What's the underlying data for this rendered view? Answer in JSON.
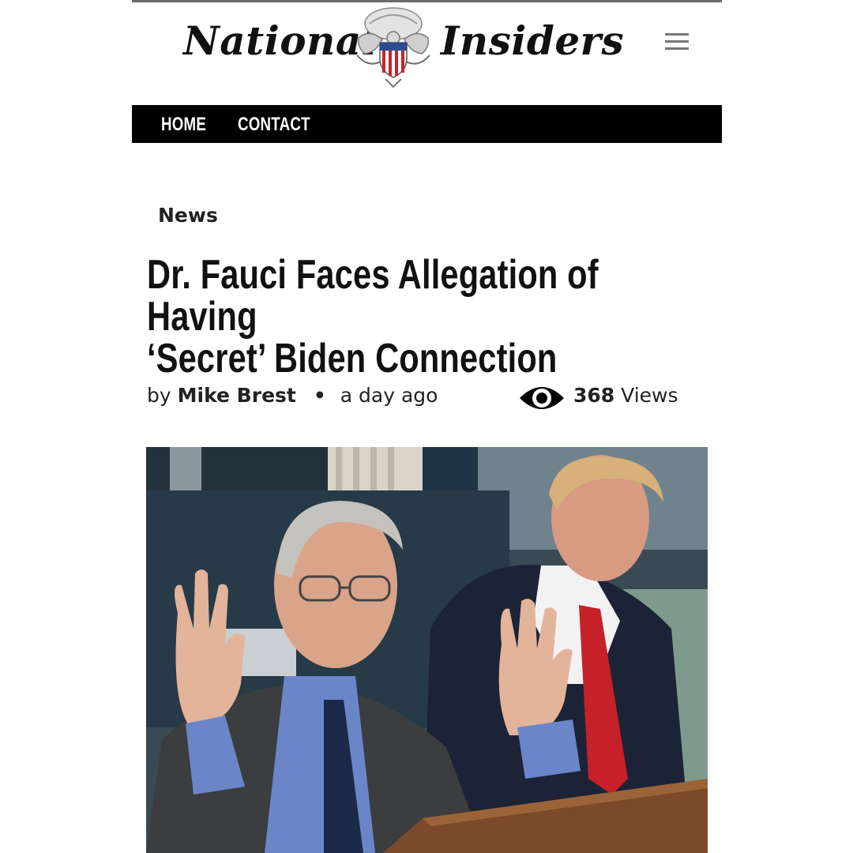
{
  "site": {
    "name_part1": "National",
    "name_part2": "Insiders"
  },
  "nav": {
    "items": [
      {
        "label": "HOME"
      },
      {
        "label": "CONTACT"
      }
    ]
  },
  "article": {
    "category": "News",
    "title_line1": "Dr. Fauci Faces Allegation of Having",
    "title_line2": "‘Secret’ Biden Connection",
    "byline_prefix": "by",
    "author": "Mike Brest",
    "separator": "•",
    "timestamp": "a day ago",
    "views_count": "368",
    "views_label": "Views"
  },
  "icons": {
    "menu": "hamburger-menu-icon",
    "views": "eye-icon",
    "logo": "eagle-seal-icon"
  },
  "colors": {
    "navbar_bg": "#000000",
    "nav_text": "#ffffff",
    "text": "#111111",
    "seal_red": "#c0262d",
    "seal_blue": "#2b4a8f"
  }
}
